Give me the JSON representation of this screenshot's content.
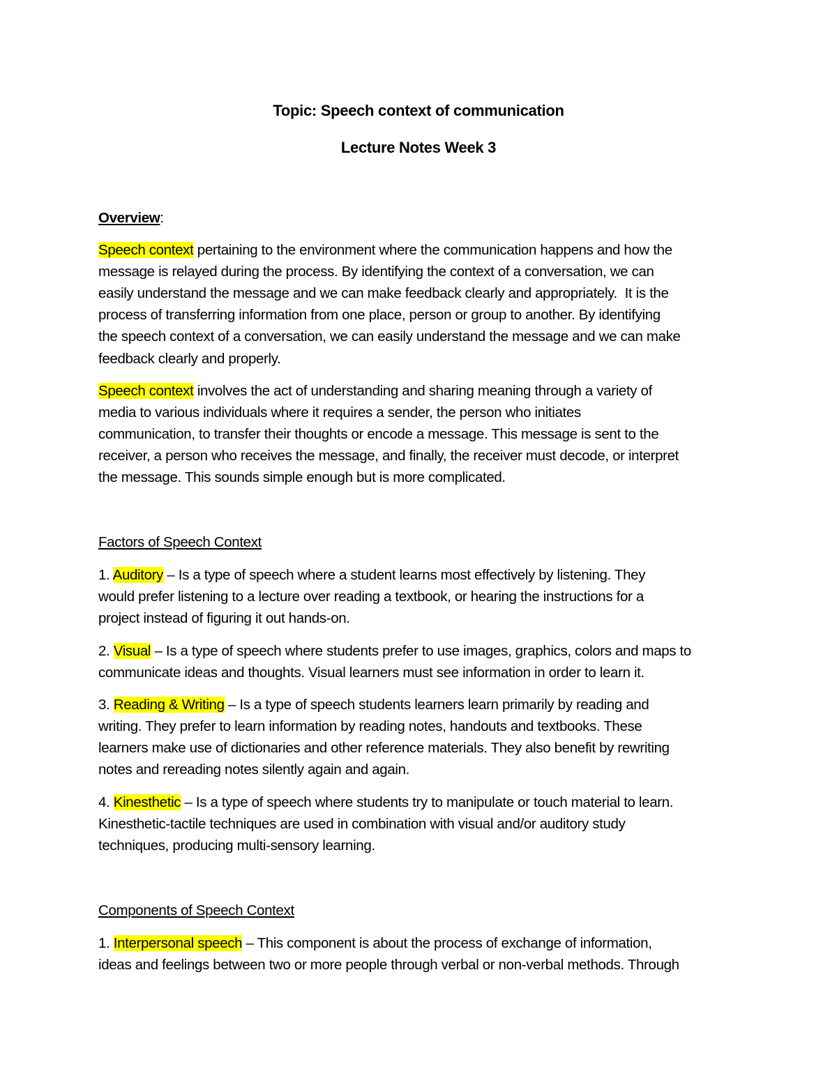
{
  "document": {
    "title": "Topic: Speech context of communication",
    "subtitle": "Lecture Notes Week 3",
    "highlight_color": "#ffff00",
    "overview": {
      "heading": "Overview",
      "heading_suffix": ":",
      "paragraphs": [
        {
          "highlight": "Speech context",
          "lines": [
            " pertaining to the environment where the communication happens and how the",
            "message is relayed during the process. By identifying the context of a conversation, we can",
            "easily understand the message and we can make feedback clearly and appropriately.  It is the",
            "process of transferring information from one place, person or group to another. By identifying",
            "the speech context of a conversation, we can easily understand the message and we can make",
            "feedback clearly and properly."
          ]
        },
        {
          "highlight": "Speech context",
          "lines": [
            " involves the act of understanding and sharing meaning through a variety of",
            "media to various individuals where it requires a sender, the person who initiates",
            "communication, to transfer their thoughts or encode a message. This message is sent to the",
            "receiver, a person who receives the message, and finally, the receiver must decode, or interpret",
            "the message. This sounds simple enough but is more complicated."
          ]
        }
      ]
    },
    "factors": {
      "heading": "Factors of Speech Context",
      "items": [
        {
          "number": "1. ",
          "term": "Auditory",
          "lines": [
            " – Is a type of speech where a student learns most effectively by listening. They",
            "would prefer listening to a lecture over reading a textbook, or hearing the instructions for a",
            "project instead of figuring it out hands-on."
          ]
        },
        {
          "number": "2. ",
          "term": "Visual",
          "lines": [
            " – Is a type of speech where students prefer to use images, graphics, colors and maps to",
            "communicate ideas and thoughts. Visual learners must see information in order to learn it."
          ]
        },
        {
          "number": "3. ",
          "term": "Reading & Writing",
          "lines": [
            " – Is a type of speech students learners learn primarily by reading and",
            "writing. They prefer to learn information by reading notes, handouts and textbooks. These",
            "learners make use of dictionaries and other reference materials. They also benefit by rewriting",
            "notes and rereading notes silently again and again."
          ]
        },
        {
          "number": "4. ",
          "term": "Kinesthetic",
          "lines": [
            " – Is a type of speech where students try to manipulate or touch material to learn.",
            "Kinesthetic-tactile techniques are used in combination with visual and/or auditory study",
            "techniques, producing multi-sensory learning."
          ]
        }
      ]
    },
    "components": {
      "heading": "Components of Speech Context",
      "items": [
        {
          "number": "1. ",
          "term": "Interpersonal speech",
          "lines": [
            " – This component is about the process of exchange of information,",
            "ideas and feelings between two or more people through verbal or non-verbal methods. Through"
          ]
        }
      ]
    }
  }
}
